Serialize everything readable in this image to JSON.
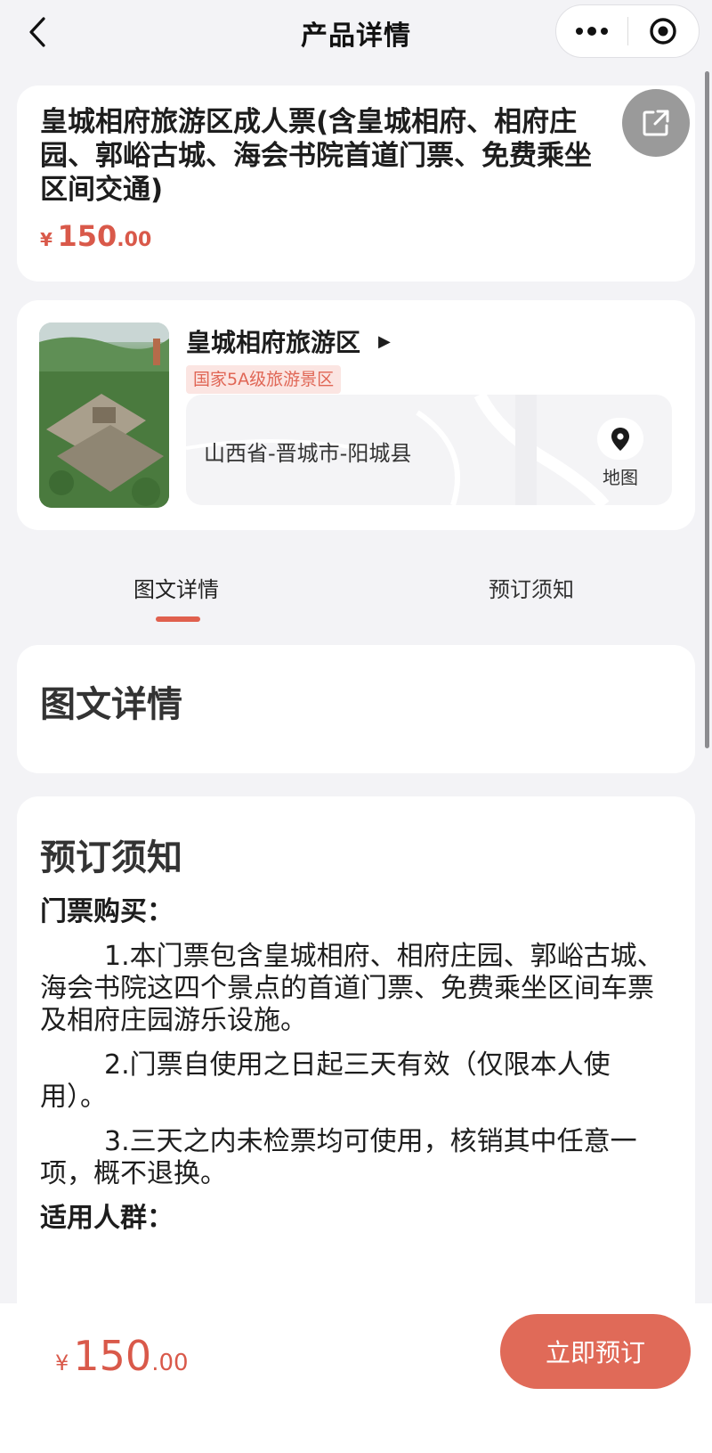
{
  "nav": {
    "title": "产品详情"
  },
  "product": {
    "title": "皇城相府旅游区成人票(含皇城相府、相府庄园、郭峪古城、海会书院首道门票、免费乘坐区间交通)",
    "price_currency": "¥",
    "price_int": "150",
    "price_dec": ".00"
  },
  "scenic": {
    "name": "皇城相府旅游区",
    "badge": "国家5A级旅游景区",
    "address": "山西省-晋城市-阳城县",
    "map_label": "地图"
  },
  "tabs": [
    {
      "label": "图文详情",
      "active": true
    },
    {
      "label": "预订须知",
      "active": false
    }
  ],
  "detail_section": {
    "heading": "图文详情"
  },
  "notice_section": {
    "heading": "预订须知",
    "purchase_title": "门票购买：",
    "items": [
      "1.本门票包含皇城相府、相府庄园、郭峪古城、海会书院这四个景点的首道门票、免费乘坐区间车票及相府庄园游乐设施。",
      "2.门票自使用之日起三天有效（仅限本人使用）。",
      "3.三天之内未检票均可使用，核销其中任意一项，概不退换。"
    ],
    "audience_title": "适用人群："
  },
  "bottom": {
    "price_currency": "¥",
    "price_int": "150",
    "price_dec": ".00",
    "book_label": "立即预订"
  },
  "colors": {
    "accent": "#e0604e",
    "price": "#d9594a",
    "badge_bg": "#fbe5e2",
    "page_bg": "#f3f3f6"
  },
  "icons": [
    "back-chevron-icon",
    "more-dots-icon",
    "target-circle-icon",
    "share-icon",
    "triangle-right-icon",
    "location-pin-icon"
  ]
}
